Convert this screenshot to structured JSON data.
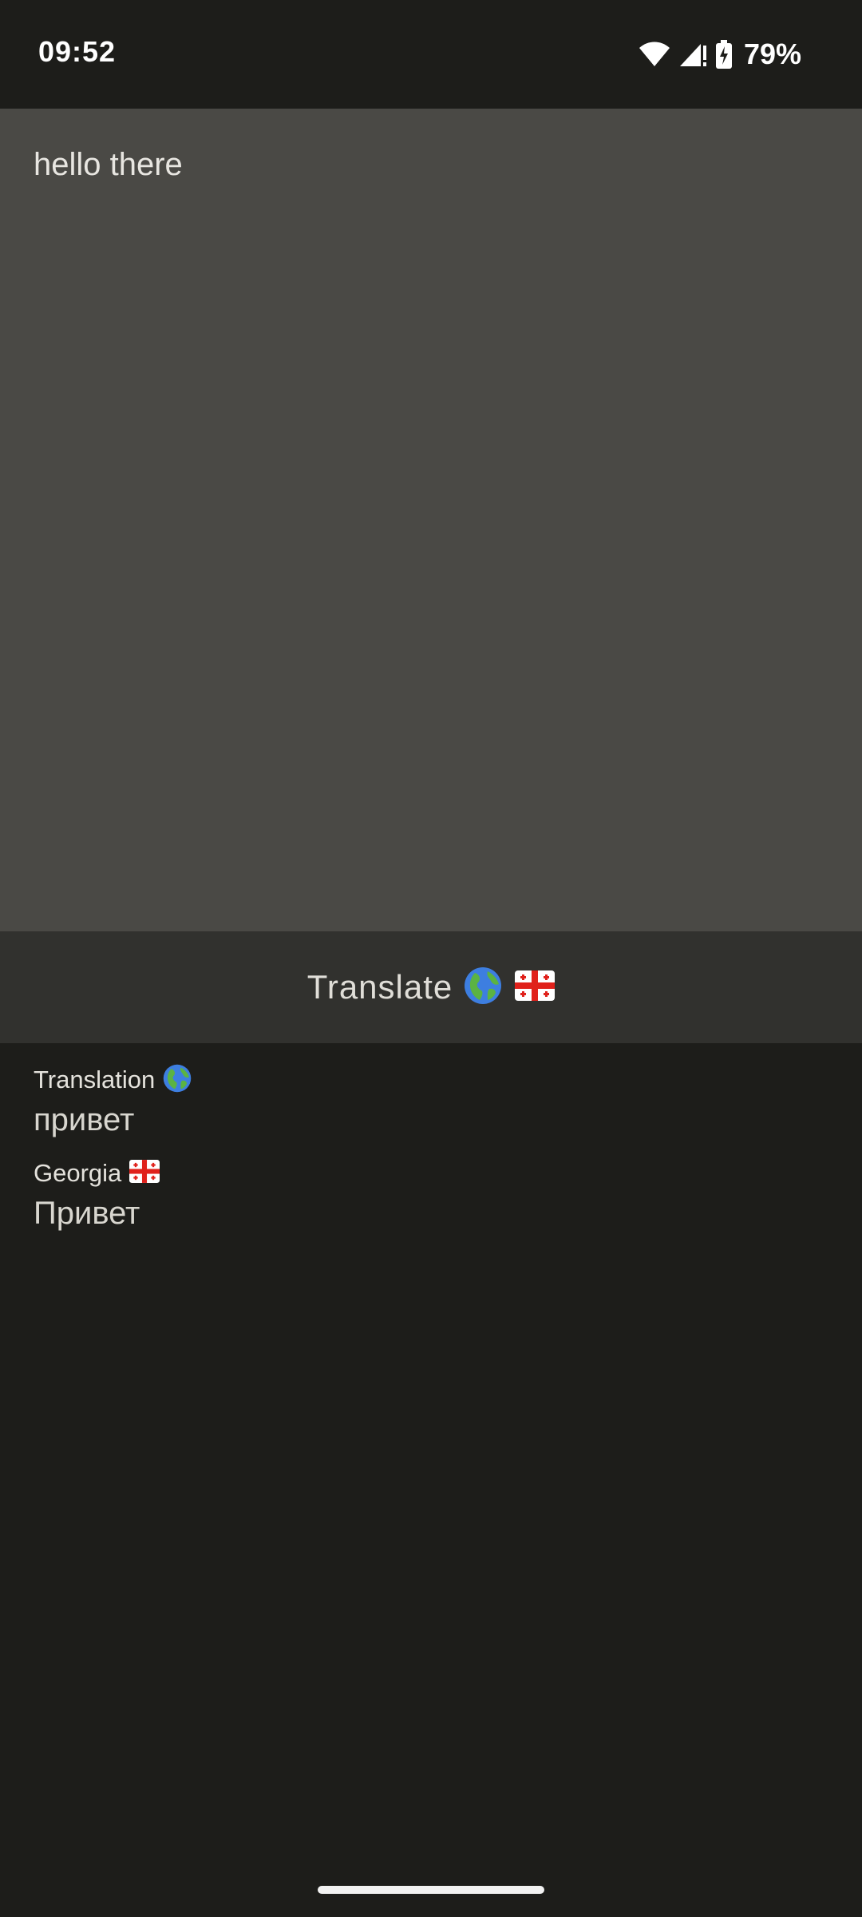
{
  "status_bar": {
    "time": "09:52",
    "battery_percent": "79%",
    "icons": [
      "wifi-icon",
      "cell-signal-icon",
      "battery-charging-icon"
    ]
  },
  "input": {
    "text": "hello there"
  },
  "translate_button": {
    "label": "Translate",
    "icons": [
      "globe-icon",
      "georgia-flag-icon"
    ]
  },
  "results": [
    {
      "label": "Translation",
      "icon": "globe-icon",
      "value": "привет"
    },
    {
      "label": "Georgia",
      "icon": "georgia-flag-icon",
      "value": "Привет"
    }
  ],
  "colors": {
    "status_bg": "#1d1d1a",
    "input_bg": "#4a4945",
    "button_bg": "#31312e",
    "page_bg": "#1d1d1a"
  }
}
